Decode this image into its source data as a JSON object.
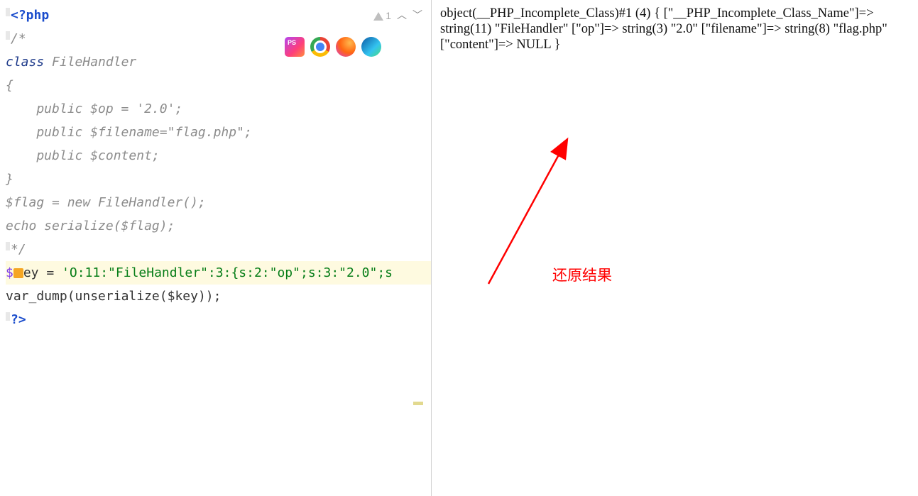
{
  "editor": {
    "warning_count": "1",
    "code": {
      "l1_open": "<?php",
      "l2": "/*",
      "l3_kw": "class ",
      "l3_name": "FileHandler",
      "l4": "{",
      "l5": "",
      "l6": "    public $op = '2.0';",
      "l7": "    public $filename=\"flag.php\";",
      "l8": "    public $content;",
      "l9": "}",
      "l10": "",
      "l11": "$flag = new FileHandler();",
      "l12": "echo serialize($flag);",
      "l13": "*/",
      "l14": "",
      "l15_var": "$",
      "l15_rest1": "ey = ",
      "l15_str": "'O:11:\"FileHandler\":3:{s:2:\"op\";s:3:\"2.0\";s",
      "l16_a": "var_dump",
      "l16_b": "(",
      "l16_c": "unserialize",
      "l16_d": "($key));",
      "l17": "?>"
    }
  },
  "icons": {
    "phpstorm": "phpstorm-icon",
    "chrome": "chrome-icon",
    "firefox": "firefox-icon",
    "edge": "edge-icon"
  },
  "output": {
    "text": "object(__PHP_Incomplete_Class)#1 (4) { [\"__PHP_Incomplete_Class_Name\"]=> string(11) \"FileHandler\" [\"op\"]=> string(3) \"2.0\" [\"filename\"]=> string(8) \"flag.php\" [\"content\"]=> NULL }"
  },
  "annotation": {
    "label": "还原结果",
    "color": "#ff0000"
  }
}
